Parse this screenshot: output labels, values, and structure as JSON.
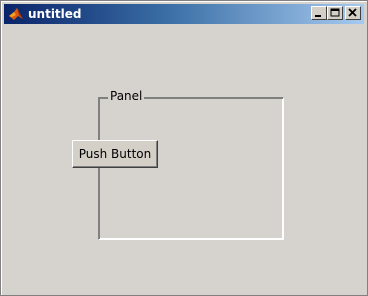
{
  "window": {
    "title": "untitled",
    "app_icon": "matlab-logo-icon",
    "controls": {
      "minimize_icon": "minimize-icon",
      "maximize_icon": "maximize-icon",
      "close_icon": "close-icon"
    }
  },
  "figure": {
    "panel": {
      "title": "Panel"
    },
    "push_button": {
      "label": "Push Button"
    }
  },
  "colors": {
    "figure_background": "#d6d3ce",
    "titlebar_start": "#0a246a",
    "titlebar_end": "#a6caf0"
  }
}
